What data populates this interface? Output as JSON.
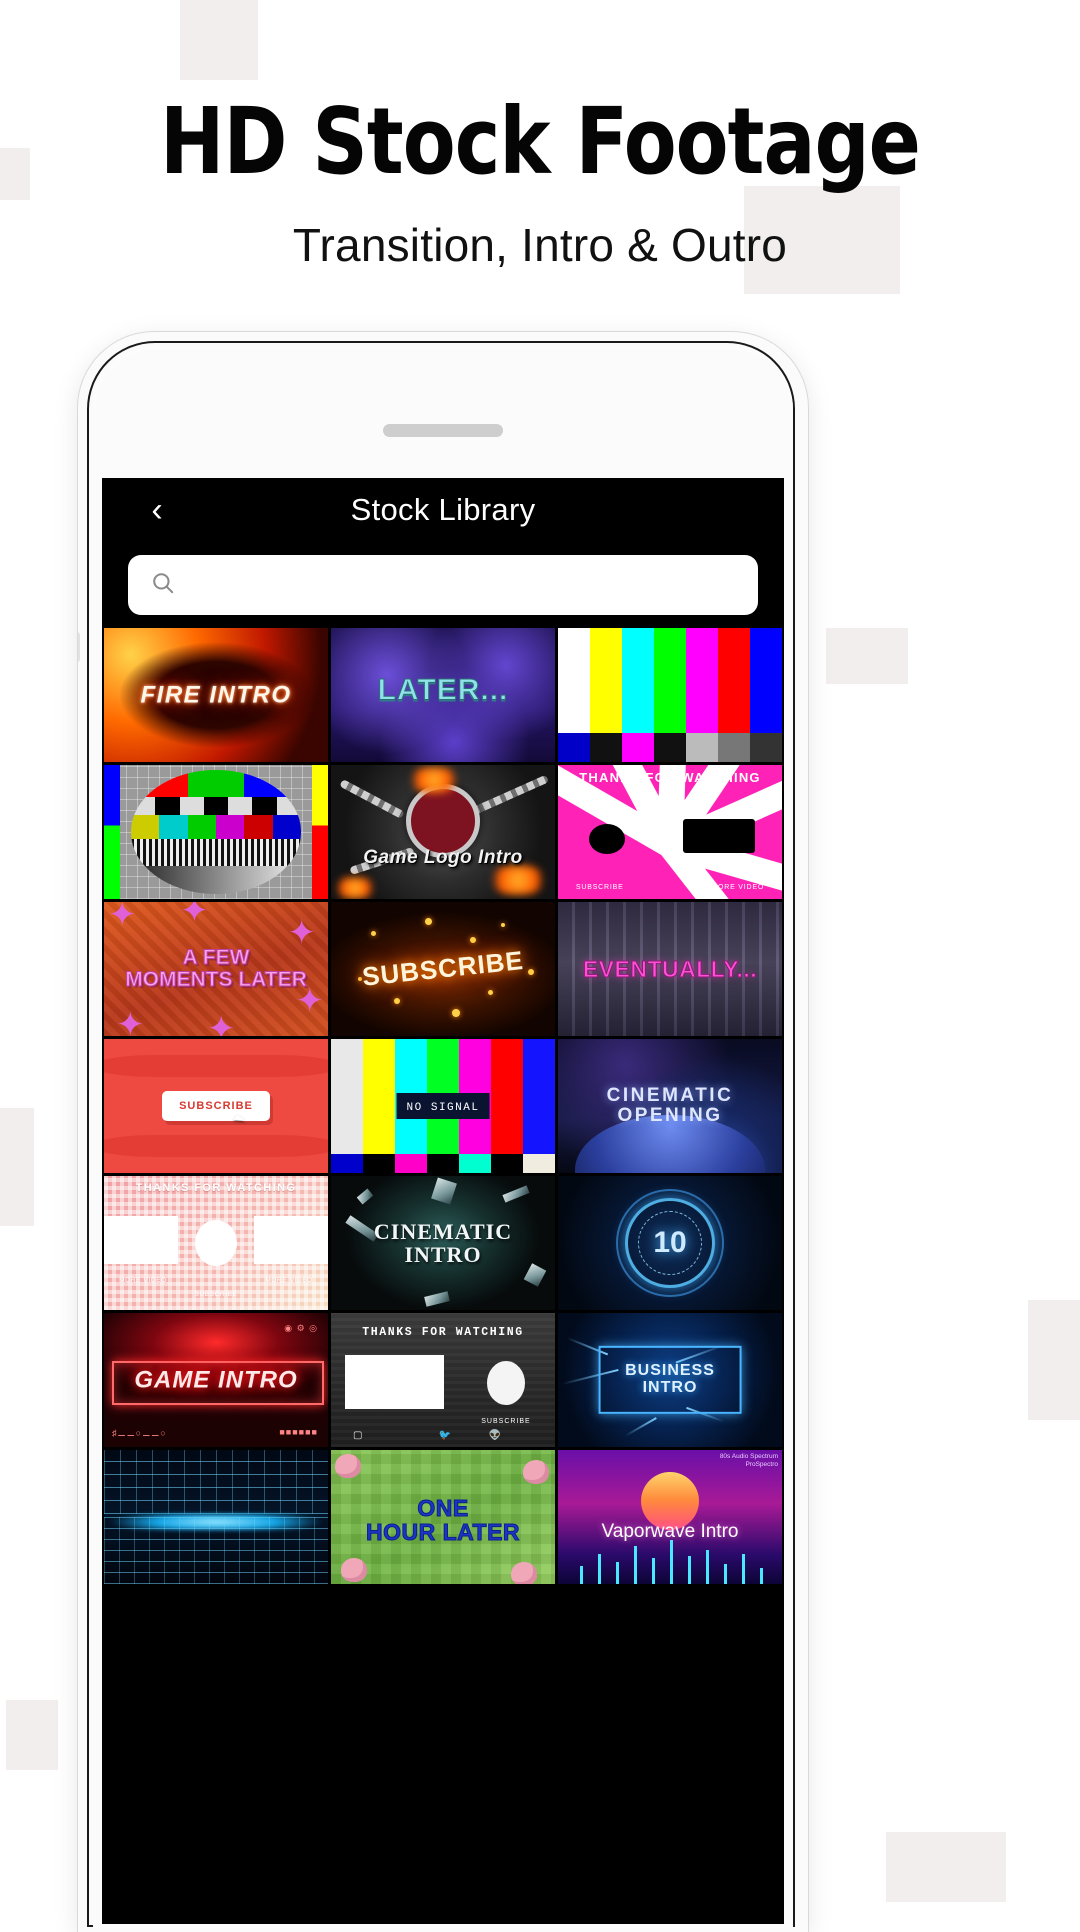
{
  "promo": {
    "headline": "HD Stock Footage",
    "subheadline": "Transition, Intro & Outro"
  },
  "app": {
    "nav": {
      "back_icon": "chevron-left-icon",
      "title": "Stock Library"
    },
    "search": {
      "icon": "search-icon",
      "value": "",
      "placeholder": ""
    },
    "grid": {
      "columns": 3,
      "items": [
        {
          "id": "fire-intro",
          "label": "FIRE INTRO",
          "style": "fire"
        },
        {
          "id": "later",
          "label": "LATER...",
          "style": "later"
        },
        {
          "id": "color-bars",
          "label": "",
          "style": "colorbars"
        },
        {
          "id": "tv-test-pattern",
          "label": "",
          "style": "testpattern"
        },
        {
          "id": "game-logo-intro",
          "label": "Game Logo Intro",
          "style": "gamelogo"
        },
        {
          "id": "thanks-pink",
          "label": "THANKS FOR WATCHING",
          "style": "pinkthanks",
          "sub_labels": [
            "SUBSCRIBE",
            "MORE VIDEO"
          ]
        },
        {
          "id": "a-few-moments",
          "label": "A FEW\nMOMENTS LATER",
          "style": "afewmoments"
        },
        {
          "id": "subscribe-fire",
          "label": "SUBSCRIBE",
          "style": "subscribefire"
        },
        {
          "id": "eventually",
          "label": "EVENTUALLY...",
          "style": "eventually"
        },
        {
          "id": "subscribe-button",
          "label": "SUBSCRIBE",
          "style": "redsubscribe"
        },
        {
          "id": "no-signal",
          "label": "NO SIGNAL",
          "style": "nosignal"
        },
        {
          "id": "cinematic-opening",
          "label": "CINEMATIC\nOPENING",
          "style": "cinematicopening"
        },
        {
          "id": "endscreen-pink",
          "label": "THANKS FOR WATCHING",
          "style": "pinkendscreen",
          "sub_labels": [
            "MORE VIDEO",
            "SUBSCRIBE",
            "MORE VIDEO"
          ]
        },
        {
          "id": "cinematic-intro",
          "label": "CINEMATIC\nINTRO",
          "style": "cinematicintro"
        },
        {
          "id": "countdown-10",
          "label": "10",
          "style": "countdown"
        },
        {
          "id": "game-intro",
          "label": "GAME INTRO",
          "style": "gameintro"
        },
        {
          "id": "endscreen-dark",
          "label": "THANKS FOR WATCHING",
          "style": "darkendscreen",
          "sub_labels": [
            "SUBSCRIBE"
          ]
        },
        {
          "id": "business-intro",
          "label": "BUSINESS\nINTRO",
          "style": "businessintro"
        },
        {
          "id": "retro-grid",
          "label": "",
          "style": "retrogrid"
        },
        {
          "id": "one-hour-later",
          "label": "ONE\nHOUR LATER",
          "style": "onehourlater"
        },
        {
          "id": "vaporwave-intro",
          "label": "Vaporwave Intro",
          "style": "vaporwave",
          "sub_labels": [
            "80s Audio Spectrum",
            "ProSpectro"
          ]
        }
      ]
    }
  },
  "colors": {
    "page_background": "#ffffff",
    "decor_square": "#f3eeee",
    "headline_text": "#050505",
    "app_bar_background": "#000000",
    "app_bar_text": "#ffffff",
    "search_background": "#ffffff",
    "search_icon": "#8b8b8b",
    "phone_frame": "#fbfbfb"
  }
}
